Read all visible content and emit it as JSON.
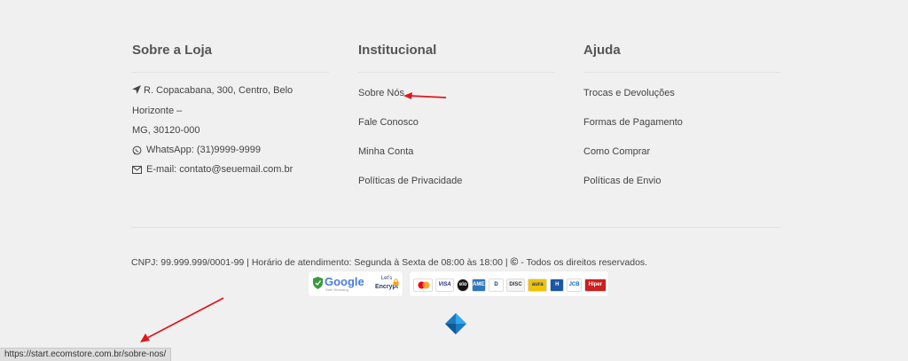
{
  "footer": {
    "store": {
      "title": "Sobre a Loja",
      "address_line1": "R. Copacabana, 300, Centro, Belo Horizonte –",
      "address_line2": "MG, 30120-000",
      "whatsapp": "WhatsApp: (31)9999-9999",
      "email": "E-mail: contato@seuemail.com.br"
    },
    "institucional": {
      "title": "Institucional",
      "links": [
        "Sobre Nós",
        "Fale Conosco",
        "Minha Conta",
        "Políticas de Privacidade"
      ]
    },
    "ajuda": {
      "title": "Ajuda",
      "links": [
        "Trocas e Devoluções",
        "Formas de Pagamento",
        "Como Comprar",
        "Políticas de Envio"
      ]
    },
    "legal": {
      "text": "CNPJ: 99.999.999/0001-99 | Horário de atendimento: Segunda à Sexta de 08:00 às 18:00 |",
      "copyright_symbol": "©",
      "rights": "- Todos os direitos reservados."
    },
    "security": {
      "google": "Google",
      "google_sub": "Safe Browsing",
      "letsencrypt_top": "Let's",
      "letsencrypt_bottom": "Encrypt"
    },
    "payment_cards": [
      {
        "name": "mastercard",
        "label": "",
        "color": "#ffffff"
      },
      {
        "name": "visa",
        "label": "VISA",
        "color": "#1a1f71"
      },
      {
        "name": "elo",
        "label": "elo",
        "color": "#111111"
      },
      {
        "name": "amex",
        "label": "AMEX",
        "color": "#2e77bc"
      },
      {
        "name": "diners",
        "label": "D",
        "color": "#0a3a7a"
      },
      {
        "name": "discover",
        "label": "DISC",
        "color": "#e6e6e6"
      },
      {
        "name": "aura",
        "label": "aura",
        "color": "#f2c200"
      },
      {
        "name": "hipercard-blue",
        "label": "H",
        "color": "#1c57a5"
      },
      {
        "name": "jcb",
        "label": "JCB",
        "color": "#0d6fb8"
      },
      {
        "name": "hipercard",
        "label": "Hiper",
        "color": "#cc1f1f"
      }
    ]
  },
  "status_bar": {
    "url": "https://start.ecomstore.com.br/sobre-nos/"
  },
  "colors": {
    "background": "#f0f0f0",
    "annotation_arrow": "#e0161b",
    "logo_blue": "#1a7bc4"
  }
}
